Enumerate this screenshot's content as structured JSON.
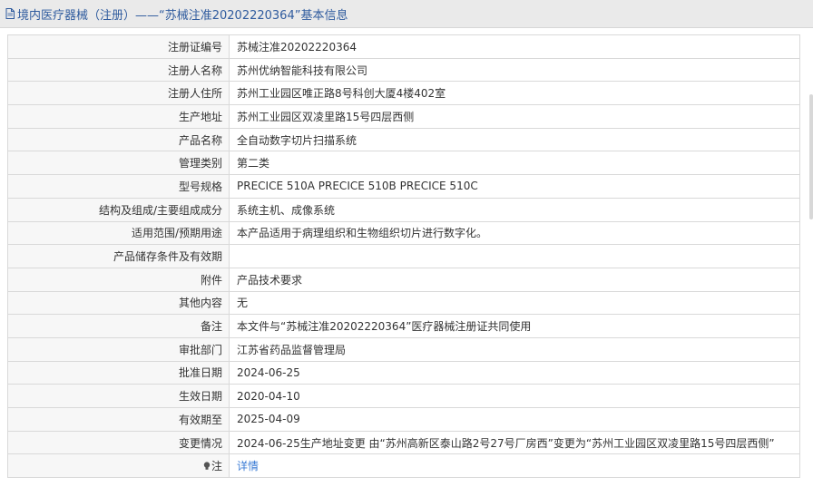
{
  "header": {
    "title": "境内医疗器械（注册）——“苏械注准20202220364”基本信息"
  },
  "rows": [
    {
      "label": "注册证编号",
      "value": "苏械注准20202220364"
    },
    {
      "label": "注册人名称",
      "value": "苏州优纳智能科技有限公司"
    },
    {
      "label": "注册人住所",
      "value": "苏州工业园区唯正路8号科创大厦4楼402室"
    },
    {
      "label": "生产地址",
      "value": "苏州工业园区双凌里路15号四层西侧"
    },
    {
      "label": "产品名称",
      "value": "全自动数字切片扫描系统"
    },
    {
      "label": "管理类别",
      "value": "第二类"
    },
    {
      "label": "型号规格",
      "value": "PRECICE 510A PRECICE 510B PRECICE 510C"
    },
    {
      "label": "结构及组成/主要组成成分",
      "value": "系统主机、成像系统"
    },
    {
      "label": "适用范围/预期用途",
      "value": "本产品适用于病理组织和生物组织切片进行数字化。"
    },
    {
      "label": "产品储存条件及有效期",
      "value": ""
    },
    {
      "label": "附件",
      "value": "产品技术要求"
    },
    {
      "label": "其他内容",
      "value": "无"
    },
    {
      "label": "备注",
      "value": "本文件与“苏械注准20202220364”医疗器械注册证共同使用"
    },
    {
      "label": "审批部门",
      "value": "江苏省药品监督管理局"
    },
    {
      "label": "批准日期",
      "value": "2024-06-25"
    },
    {
      "label": "生效日期",
      "value": "2020-04-10"
    },
    {
      "label": "有效期至",
      "value": "2025-04-09"
    },
    {
      "label": "变更情况",
      "value": "2024-06-25生产地址变更 由“苏州高新区泰山路2号27号厂房西”变更为“苏州工业园区双凌里路15号四层西侧”"
    }
  ],
  "note": {
    "label": "注",
    "link_text": "详情"
  },
  "colors": {
    "header_text": "#2f5b9e",
    "link": "#3a7bd5",
    "label_bg": "#f7f7f7",
    "border": "#d9d9d9"
  },
  "icons": {
    "header": "document-icon",
    "note": "lightbulb-icon"
  }
}
